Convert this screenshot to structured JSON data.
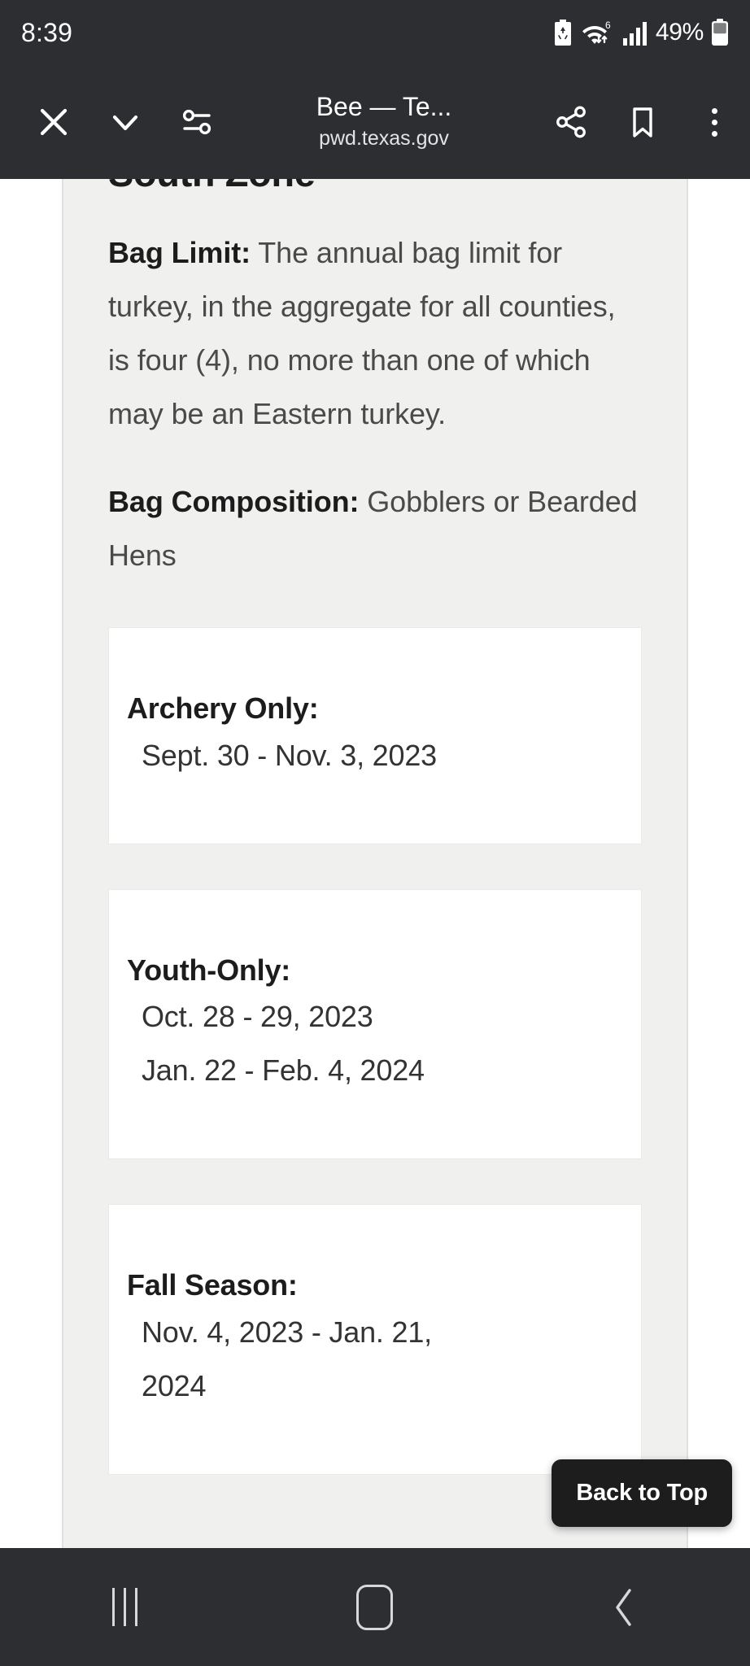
{
  "status_bar": {
    "clock": "8:39",
    "battery_percent": "49%",
    "icons": [
      "battery-saver-icon",
      "wifi-icon",
      "cellular-signal-icon",
      "battery-icon"
    ],
    "wifi_generation": "6"
  },
  "browser_bar": {
    "close_label": "close-icon",
    "chevron_label": "chevron-down-icon",
    "page_info_label": "page-info-icon",
    "title": "Bee — Te...",
    "url": "pwd.texas.gov",
    "share_label": "share-icon",
    "bookmark_label": "bookmark-icon",
    "menu_label": "overflow-menu-icon"
  },
  "page": {
    "zone_heading": "South Zone",
    "bag_limit": {
      "label": "Bag Limit:",
      "text": " The annual bag limit for turkey, in the aggregate for all counties, is four (4), no more than one of which may be an Eastern turkey."
    },
    "bag_composition": {
      "label": "Bag Composition:",
      "text": " Gobblers or Bearded Hens"
    },
    "seasons": [
      {
        "title": "Archery Only:",
        "dates": [
          "Sept. 30 - Nov. 3, 2023"
        ]
      },
      {
        "title": "Youth-Only:",
        "dates": [
          "Oct. 28 - 29, 2023",
          "Jan. 22 - Feb. 4, 2024"
        ]
      },
      {
        "title": "Fall Season:",
        "dates": [
          "Nov. 4, 2023 - Jan. 21,",
          "2024"
        ]
      }
    ]
  },
  "floating": {
    "back_to_top": "Back to Top"
  },
  "nav_bar": {
    "recents": "recents-icon",
    "home": "home-icon",
    "back": "back-icon"
  },
  "colors": {
    "system_chrome": "#2c2e32",
    "page_bg": "#f0f0ef",
    "card_bg": "#ffffff",
    "heading_text": "#1c1c1c",
    "body_text": "#4a4a4a",
    "fab_bg": "#1d1d1d"
  }
}
